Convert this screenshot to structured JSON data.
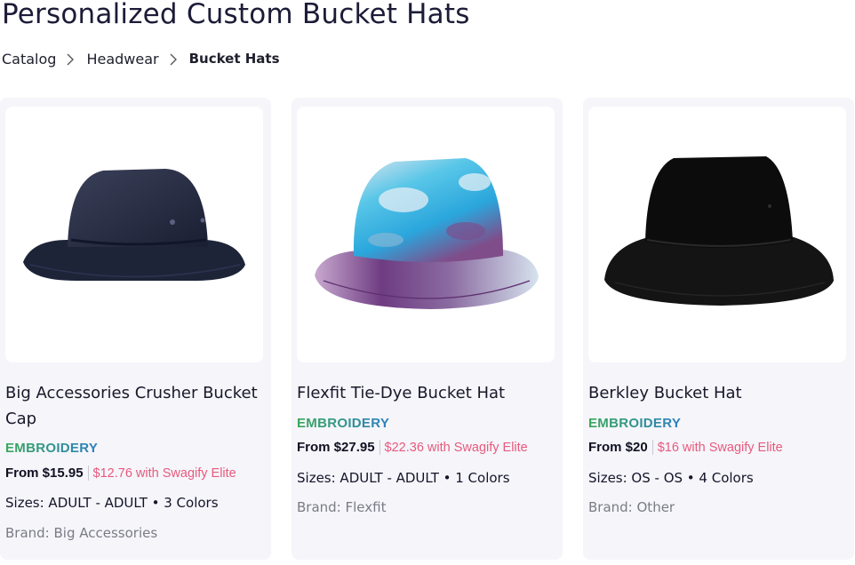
{
  "page": {
    "title": "Personalized Custom Bucket Hats"
  },
  "breadcrumb": {
    "items": [
      "Catalog",
      "Headwear",
      "Bucket Hats"
    ]
  },
  "colors": {
    "badge_gradient": [
      "#3aa85a",
      "#2b7fc0"
    ],
    "elite_price": "#e85a7d",
    "card_bg": "#f5f5fa"
  },
  "products": [
    {
      "title": "Big Accessories Crusher Bucket Cap",
      "badge": "EMBROIDERY",
      "price": "From $15.95",
      "elite_price": "$12.76 with Swagify Elite",
      "sizes": "Sizes: ADULT - ADULT • 3 Colors",
      "brand": "Brand: Big Accessories",
      "image_icon": "navy-bucket-hat-image"
    },
    {
      "title": "Flexfit Tie-Dye Bucket Hat",
      "badge": "EMBROIDERY",
      "price": "From $27.95",
      "elite_price": "$22.36 with Swagify Elite",
      "sizes": "Sizes: ADULT - ADULT • 1 Colors",
      "brand": "Brand: Flexfit",
      "image_icon": "tie-dye-bucket-hat-image"
    },
    {
      "title": "Berkley Bucket Hat",
      "badge": "EMBROIDERY",
      "price": "From $20",
      "elite_price": "$16 with Swagify Elite",
      "sizes": "Sizes: OS - OS • 4 Colors",
      "brand": "Brand: Other",
      "image_icon": "black-bucket-hat-image"
    }
  ]
}
